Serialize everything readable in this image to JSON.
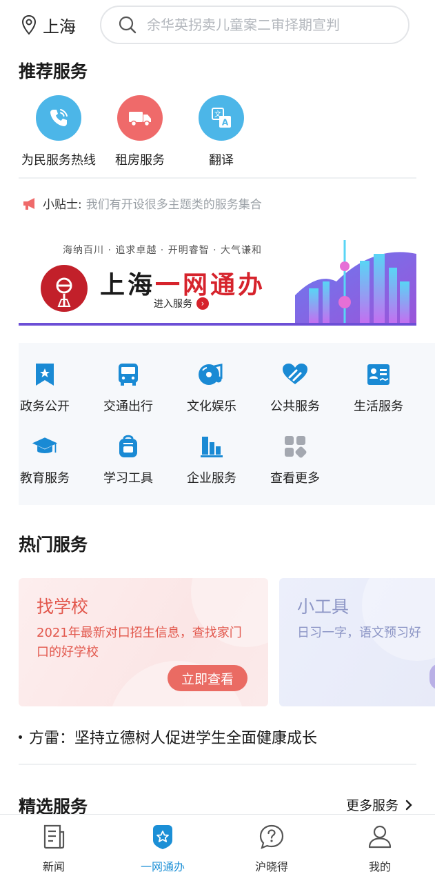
{
  "header": {
    "city": "上海",
    "search_placeholder": "余华英拐卖儿童案二审择期宣判"
  },
  "recommended": {
    "title": "推荐服务",
    "items": [
      {
        "label": "为民服务热线",
        "icon": "phone-icon",
        "color": "#4cb6e8"
      },
      {
        "label": "租房服务",
        "icon": "truck-icon",
        "color": "#ef6a6a"
      },
      {
        "label": "翻译",
        "icon": "translate-icon",
        "color": "#4cb6e8"
      }
    ]
  },
  "tip": {
    "label": "小贴士:",
    "text": "我们有开设很多主题类的服务集合"
  },
  "banner": {
    "slogan": "海纳百川 · 追求卓越 · 开明睿智 · 大气谦和",
    "title_part1": "上海",
    "title_part2": "一网通办",
    "enter": "进入服务"
  },
  "categories": [
    {
      "label": "政务公开",
      "icon": "bookmark-star-icon"
    },
    {
      "label": "交通出行",
      "icon": "bus-icon"
    },
    {
      "label": "文化娱乐",
      "icon": "music-disc-icon"
    },
    {
      "label": "公共服务",
      "icon": "heart-hands-icon"
    },
    {
      "label": "生活服务",
      "icon": "id-card-icon"
    },
    {
      "label": "教育服务",
      "icon": "graduation-cap-icon"
    },
    {
      "label": "学习工具",
      "icon": "backpack-icon"
    },
    {
      "label": "企业服务",
      "icon": "building-chart-icon"
    },
    {
      "label": "查看更多",
      "icon": "more-grid-icon"
    }
  ],
  "hot": {
    "title": "热门服务",
    "cards": [
      {
        "title": "找学校",
        "desc": "2021年最新对口招生信息，查找家门口的好学校",
        "button": "立即查看"
      },
      {
        "title": "小工具",
        "desc": "日习一字，语文预习好"
      }
    ],
    "news": "方雷：坚持立德树人促进学生全面健康成长"
  },
  "featured": {
    "title": "精选服务",
    "more": "更多服务"
  },
  "bottom_nav": [
    {
      "label": "新闻",
      "icon": "news-doc-icon"
    },
    {
      "label": "一网通办",
      "icon": "star-badge-icon",
      "active": true
    },
    {
      "label": "沪晓得",
      "icon": "question-bubble-icon"
    },
    {
      "label": "我的",
      "icon": "user-icon"
    }
  ],
  "colors": {
    "accent_blue": "#1b8fd6",
    "icon_blue": "#1a8ad4",
    "brand_red": "#d6232c"
  }
}
